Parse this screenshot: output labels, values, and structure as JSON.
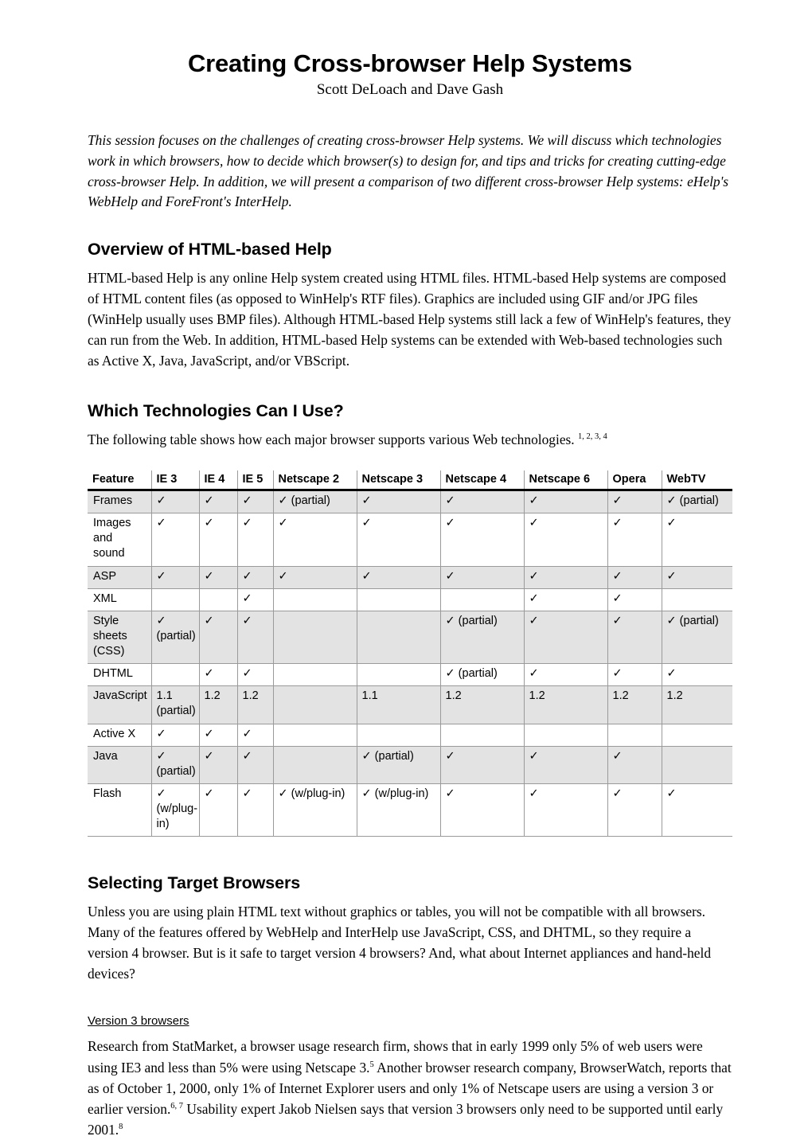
{
  "document": {
    "title": "Creating Cross-browser Help Systems",
    "authors": "Scott DeLoach and Dave Gash",
    "abstract": "This session focuses on the challenges of creating cross-browser Help systems. We will discuss which technologies work in which browsers, how to decide which browser(s) to design for, and tips and tricks for creating cutting-edge cross-browser Help. In addition, we will present a comparison of two different cross-browser Help systems: eHelp's WebHelp and ForeFront's InterHelp."
  },
  "sections": {
    "overview": {
      "heading": "Overview of HTML-based Help",
      "paragraph": "HTML-based Help is any online Help system created using HTML files. HTML-based Help systems are composed of HTML content files (as opposed to WinHelp's RTF files). Graphics are included using GIF and/or JPG files (WinHelp usually uses BMP files). Although HTML-based Help systems still lack a few of WinHelp's features, they can run from the Web. In addition, HTML-based Help systems can be extended with Web-based technologies such as Active X, Java, JavaScript, and/or VBScript."
    },
    "technologies": {
      "heading": "Which Technologies Can I Use?",
      "intro": "The following table shows how each major browser supports various Web technologies.",
      "intro_footnotes": "1, 2, 3, 4"
    },
    "targets": {
      "heading": "Selecting Target Browsers",
      "paragraph": "Unless you are using plain HTML text without graphics or tables, you will not be compatible with all browsers. Many of the features offered by WebHelp and InterHelp use JavaScript, CSS, and DHTML, so they require a version 4 browser. But is it safe to target version 4 browsers? And, what about Internet appliances and hand-held devices?"
    },
    "version3": {
      "heading": "Version 3 browsers",
      "part1": "Research from StatMarket, a browser usage research firm, shows that in early 1999 only 5% of web users were using IE3 and less than 5% were using Netscape 3.",
      "fn1": "5",
      "part2": " Another browser research company, BrowserWatch, reports that as of October 1, 2000, only 1% of Internet Explorer users and only 1% of Netscape users are using a version 3 or earlier version.",
      "fn2": "6, 7",
      "part3": " Usability expert Jakob Nielsen says that version 3 browsers only need to be supported until early 2001.",
      "fn3": "8"
    }
  },
  "table": {
    "columns": [
      "Feature",
      "IE 3",
      "IE 4",
      "IE 5",
      "Netscape 2",
      "Netscape 3",
      "Netscape 4",
      "Netscape 6",
      "Opera",
      "WebTV"
    ],
    "rows": [
      {
        "feature": "Frames",
        "shaded": true,
        "cells": [
          "✓",
          "✓",
          "✓",
          "✓ (partial)",
          "✓",
          "✓",
          "✓",
          "✓",
          "✓ (partial)"
        ]
      },
      {
        "feature": "Images and sound",
        "shaded": false,
        "cells": [
          "✓",
          "✓",
          "✓",
          "✓",
          "✓",
          "✓",
          "✓",
          "✓",
          "✓"
        ]
      },
      {
        "feature": "ASP",
        "shaded": true,
        "cells": [
          "✓",
          "✓",
          "✓",
          "✓",
          "✓",
          "✓",
          "✓",
          "✓",
          "✓"
        ]
      },
      {
        "feature": "XML",
        "shaded": false,
        "cells": [
          "",
          "",
          "✓",
          "",
          "",
          "",
          "✓",
          "✓",
          ""
        ]
      },
      {
        "feature": "Style sheets (CSS)",
        "shaded": true,
        "cells": [
          "✓ (partial)",
          "✓",
          "✓",
          "",
          "",
          "✓ (partial)",
          "✓",
          "✓",
          "✓ (partial)"
        ]
      },
      {
        "feature": "DHTML",
        "shaded": false,
        "cells": [
          "",
          "✓",
          "✓",
          "",
          "",
          "✓ (partial)",
          "✓",
          "✓",
          "✓"
        ]
      },
      {
        "feature": "JavaScript",
        "shaded": true,
        "cells": [
          "1.1 (partial)",
          "1.2",
          "1.2",
          "",
          "1.1",
          "1.2",
          "1.2",
          "1.2",
          "1.2"
        ]
      },
      {
        "feature": "Active X",
        "shaded": false,
        "cells": [
          "✓",
          "✓",
          "✓",
          "",
          "",
          "",
          "",
          "",
          ""
        ]
      },
      {
        "feature": "Java",
        "shaded": true,
        "cells": [
          "✓ (partial)",
          "✓",
          "✓",
          "",
          "✓ (partial)",
          "✓",
          "✓",
          "✓",
          ""
        ]
      },
      {
        "feature": "Flash",
        "shaded": false,
        "cells": [
          "✓ (w/plug-in)",
          "✓",
          "✓",
          "✓ (w/plug-in)",
          "✓ (w/plug-in)",
          "✓",
          "✓",
          "✓",
          "✓"
        ]
      }
    ]
  },
  "colors": {
    "text": "#000000",
    "page_background": "#ffffff",
    "table_row_shade": "#e3e3e3",
    "table_rule": "#9a9a9a"
  }
}
